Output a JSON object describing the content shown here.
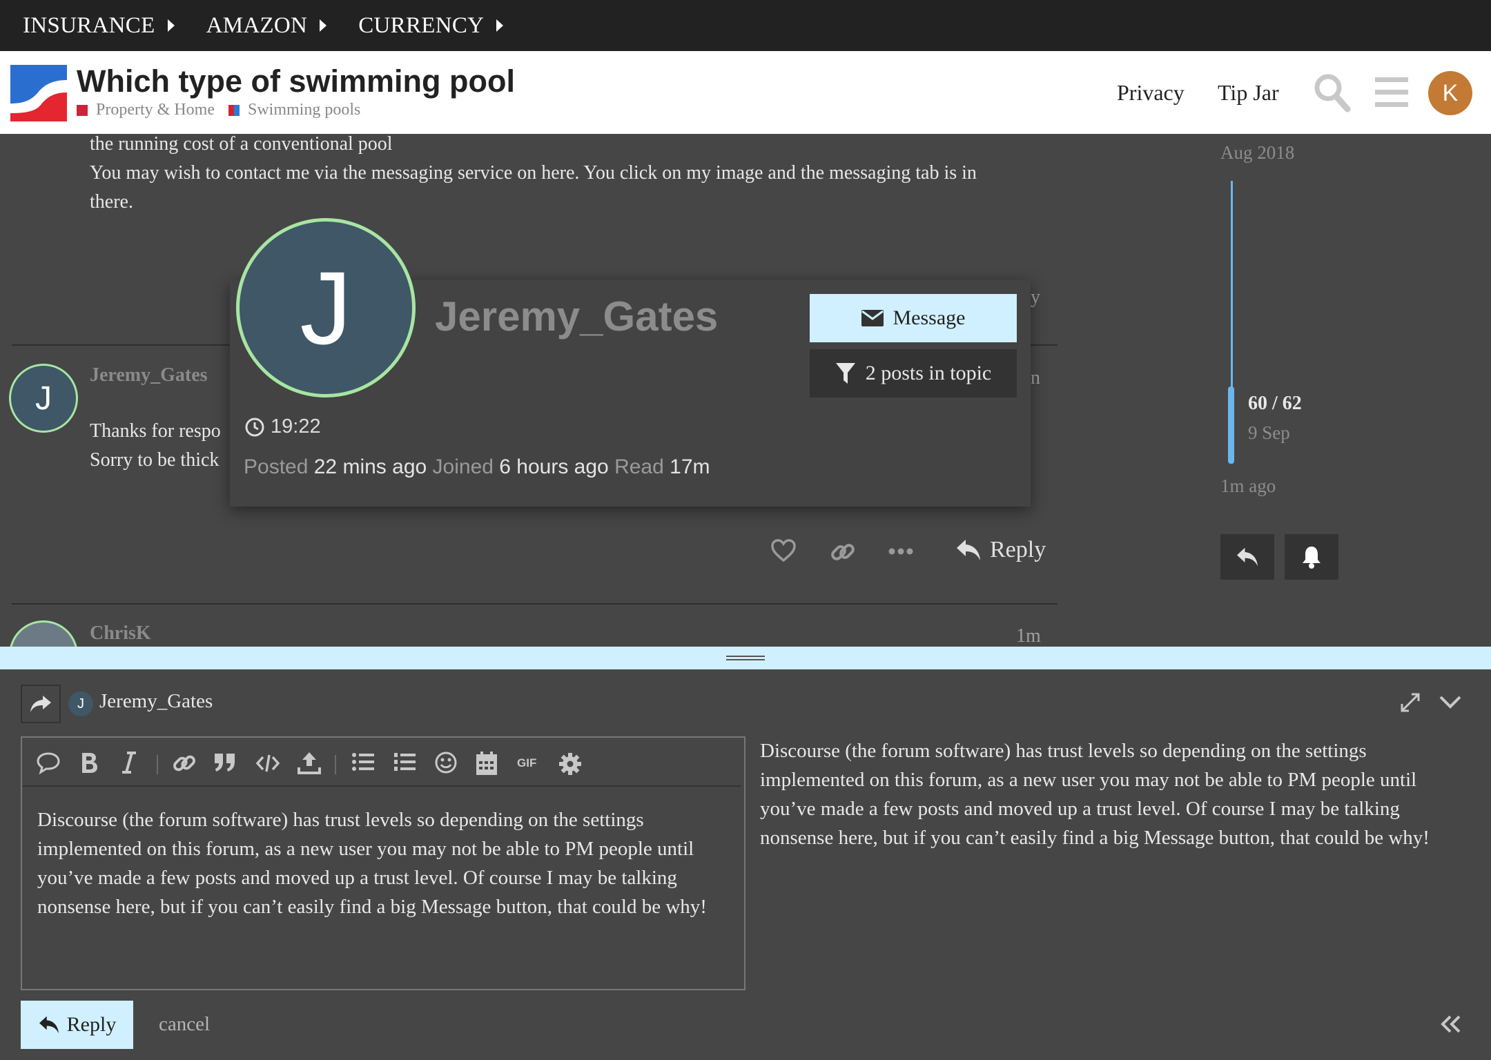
{
  "topnav": {
    "items": [
      "INSURANCE",
      "AMAZON",
      "CURRENCY"
    ]
  },
  "header": {
    "title": "Which type of swimming pool",
    "categories": [
      {
        "name": "Property & Home",
        "color": "#d0233a"
      },
      {
        "name": "Swimming pools",
        "color": "#2a7bd6"
      }
    ],
    "links": {
      "privacy": "Privacy",
      "tip_jar": "Tip Jar"
    },
    "avatar_letter": "K",
    "avatar_color": "#c27a34"
  },
  "stream": {
    "prev_post_lines": [
      "the running cost of a conventional pool",
      "You may wish to contact me via the messaging service on here. You click on my image and the messaging tab is in",
      "there."
    ],
    "prev_post_fragment": "y",
    "post": {
      "username": "Jeremy_Gates",
      "avatar_letter": "J",
      "time_fragment": "n",
      "lines": [
        "Thanks for respo",
        "Sorry to be thick"
      ],
      "reply_label": "Reply"
    },
    "next_post": {
      "username": "ChrisK",
      "time": "1m"
    }
  },
  "usercard": {
    "avatar_letter": "J",
    "name": "Jeremy_Gates",
    "message_button": "Message",
    "posts_button": "2 posts in topic",
    "local_time": "19:22",
    "stats": {
      "posted_label": "Posted",
      "posted_value": "22 mins ago",
      "joined_label": "Joined",
      "joined_value": "6 hours ago",
      "read_label": "Read",
      "read_value": "17m"
    }
  },
  "timeline": {
    "start_date": "Aug 2018",
    "position": "60 / 62",
    "position_date": "9 Sep",
    "end_label": "1m ago",
    "accent_color": "#6ab7ee"
  },
  "composer": {
    "recipient_letter": "J",
    "recipient": "Jeremy_Gates",
    "toolbar_icons": [
      "quote-icon",
      "bold-icon",
      "italic-icon",
      "link-icon",
      "blockquote-icon",
      "code-icon",
      "upload-icon",
      "bullet-list-icon",
      "numbered-list-icon",
      "emoji-icon",
      "calendar-icon",
      "gif-icon",
      "gear-icon"
    ],
    "gif_label": "GIF",
    "text_lines": [
      "Discourse (the forum software) has trust levels so depending on the settings",
      "implemented on this forum, as a new user you may not be able to PM people until",
      "you’ve made a few posts and moved up a trust level. Of course I may be talking",
      "nonsense here, but if you can’t easily find a big Message button, that could be why!"
    ],
    "submit_label": "Reply",
    "cancel_label": "cancel",
    "accent_color": "#d1f0ff"
  }
}
